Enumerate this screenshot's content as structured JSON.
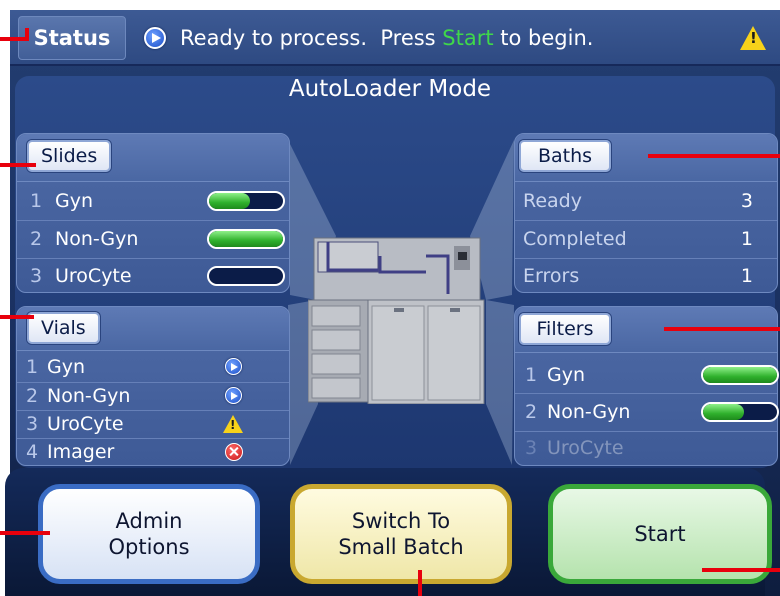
{
  "status": {
    "tab_label": "Status",
    "message_prefix": "Ready to process.  Press ",
    "message_highlight": "Start",
    "message_suffix": " to begin."
  },
  "mode_title": "AutoLoader Mode",
  "slides": {
    "button_label": "Slides",
    "items": [
      {
        "num": "1",
        "label": "Gyn",
        "fill": 0.55
      },
      {
        "num": "2",
        "label": "Non-Gyn",
        "fill": 1.0
      },
      {
        "num": "3",
        "label": "UroCyte",
        "fill": 0.0
      }
    ]
  },
  "vials": {
    "button_label": "Vials",
    "items": [
      {
        "num": "1",
        "label": "Gyn",
        "icon": "arrow-icon"
      },
      {
        "num": "2",
        "label": "Non-Gyn",
        "icon": "arrow-icon"
      },
      {
        "num": "3",
        "label": "UroCyte",
        "icon": "warning-icon"
      },
      {
        "num": "4",
        "label": "Imager",
        "icon": "error-icon"
      }
    ]
  },
  "baths": {
    "button_label": "Baths",
    "rows": [
      {
        "label": "Ready",
        "value": "3"
      },
      {
        "label": "Completed",
        "value": "1"
      },
      {
        "label": "Errors",
        "value": "1"
      }
    ]
  },
  "filters": {
    "button_label": "Filters",
    "items": [
      {
        "num": "1",
        "label": "Gyn",
        "fill": 1.0
      },
      {
        "num": "2",
        "label": "Non-Gyn",
        "fill": 0.55
      },
      {
        "num": "3",
        "label": "UroCyte",
        "fill": null
      }
    ]
  },
  "buttons": {
    "admin_line1": "Admin",
    "admin_line2": "Options",
    "switch_line1": "Switch To",
    "switch_line2": "Small Batch",
    "start": "Start"
  },
  "colors": {
    "highlight_green": "#3fd84a",
    "callout_red": "#e8000d"
  }
}
